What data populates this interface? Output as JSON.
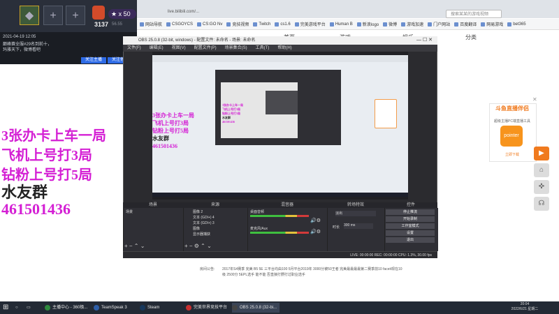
{
  "browser": {
    "url": "live.bilibili.com/...",
    "search_placeholder": "搜索某某的游戏视频",
    "bookmarks": [
      "网站导航",
      "CSGOYCS",
      "CS:GO Nv",
      "竞技视频",
      "Twitch",
      "cs1.6",
      "完美游戏平台",
      "Human B",
      "新浪logo",
      "微博",
      "游戏加速",
      "门户网站",
      "百度翻译",
      "网易游戏",
      "bet365"
    ],
    "nav": [
      "首页",
      "游戏",
      "娱乐",
      "分类"
    ]
  },
  "left_panel": {
    "rank_number": "3137",
    "rank_sub": "56.55",
    "stars": "★ x 50",
    "info_time": "2021-04-19 12:05",
    "info_text": "巅峰赛全服#29名到前十，玛雅天下，微博看吧",
    "btn_follow": "关注主播",
    "btn_share": "关注他们"
  },
  "overlay_text": {
    "line1": "3张办卡上车一局",
    "line2": "飞机上号打3局",
    "line3": "钻粉上号打5局",
    "line4": "水友群",
    "line5": "461501436"
  },
  "obs": {
    "title": "OBS 25.0.8 (32-bit, windows) - 配置文件: 未命名 - 场景: 未命名",
    "menu": [
      "文件(F)",
      "编辑(E)",
      "视图(V)",
      "配置文件(P)",
      "场景集合(S)",
      "工具(T)",
      "帮助(H)"
    ],
    "docks": [
      "场景",
      "来源",
      "混音器",
      "转场特效",
      "控件"
    ],
    "scene_item": "场景",
    "sources": [
      "图像 2",
      "文本 (GDI+) 4",
      "文本 (GDI+) 3",
      "图像",
      "显示器捕获"
    ],
    "mixer": [
      "桌面音频",
      "麦克风/Aux"
    ],
    "transition": "淡出",
    "duration_label": "时长",
    "duration_value": "300 ms",
    "controls": [
      "停止推流",
      "开始录制",
      "工作室模式",
      "设置",
      "退出"
    ],
    "status": "LIVE: 00:00:00   REC: 00:00:00   CPU: 1.3%, 30.00 fps"
  },
  "ad": {
    "title": "斗鱼直播伴侣",
    "sub": "超级主播PC端直播工具",
    "icon": "pointer",
    "button": "立即下载"
  },
  "page_text": {
    "label": "房间公告:",
    "body": "2017年S4赛季 完美 B5 5E 三平台均由100 5月平台2019年 3000分被50王者 完美最最最最第二赛季前10 faceit现在10级 2500分 5EPL选手 能不能 否直接打野打过职业选手"
  },
  "taskbar": {
    "items": [
      "主播中心 - 360极...",
      "TeamSpeak 3",
      "Steam",
      "完美世界竞技平台",
      "OBS 25.0.8 (32-bi..."
    ],
    "time": "20:04",
    "date": "2022/6/21 星期二"
  },
  "colors": {
    "overlay_text": "#d41fd4",
    "accent": "#f07a1e"
  }
}
